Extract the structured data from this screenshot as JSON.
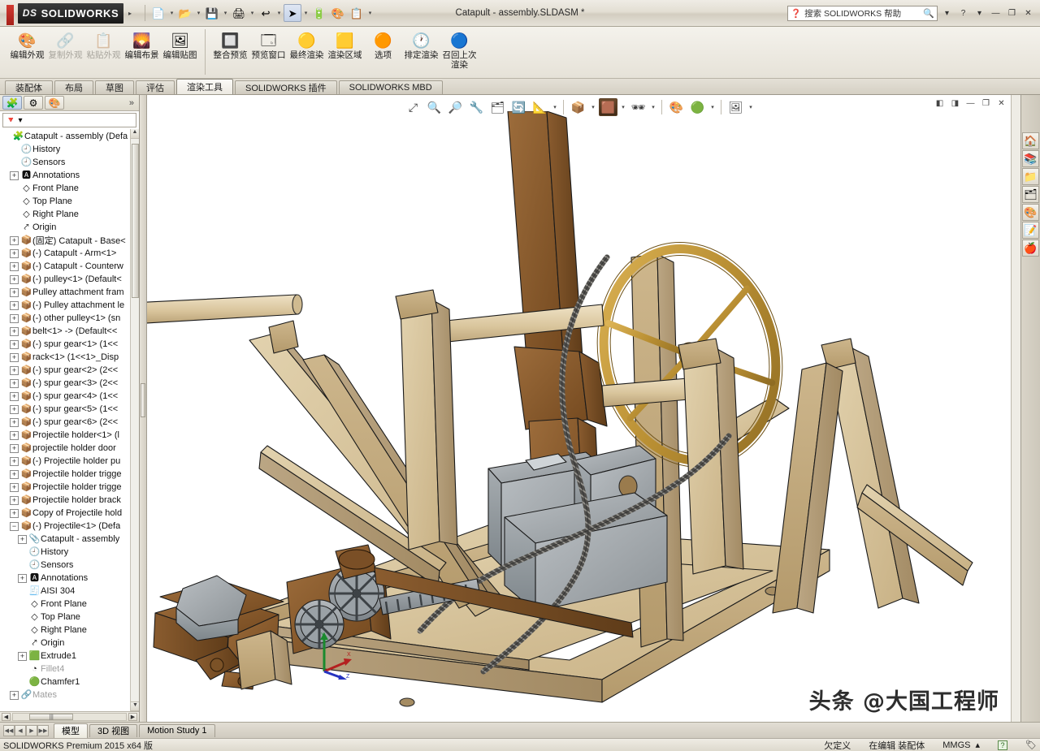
{
  "window": {
    "title": "Catapult - assembly.SLDASM *",
    "brand": "SOLIDWORKS",
    "brand_prefix": "DS",
    "search_placeholder": "搜索 SOLIDWORKS 帮助",
    "help_label": "?",
    "minimize_label": "—",
    "maximize_label": "❐",
    "close_label": "✕"
  },
  "quick_access": [
    {
      "name": "new-document",
      "icon": "📄"
    },
    {
      "name": "open-document",
      "icon": "📂"
    },
    {
      "name": "save-document",
      "icon": "💾"
    },
    {
      "name": "print",
      "icon": "🖨"
    },
    {
      "name": "undo",
      "icon": "↩"
    },
    {
      "name": "select",
      "icon": "➤"
    },
    {
      "name": "measure",
      "icon": "🔋"
    },
    {
      "name": "appearance",
      "icon": "🎨"
    },
    {
      "name": "options",
      "icon": "📋"
    }
  ],
  "ribbon": {
    "groups": [
      {
        "buttons": [
          {
            "label": "编辑外观",
            "icon": "🎨",
            "enabled": true
          },
          {
            "label": "复制外观",
            "icon": "🔗",
            "enabled": false
          },
          {
            "label": "粘贴外观",
            "icon": "📋",
            "enabled": false
          },
          {
            "label": "编辑布景",
            "icon": "🌄",
            "enabled": true
          },
          {
            "label": "编辑贴图",
            "icon": "🖼",
            "enabled": true
          }
        ]
      },
      {
        "buttons": [
          {
            "label": "整合预览",
            "icon": "🔲",
            "enabled": true
          },
          {
            "label": "预览窗口",
            "icon": "🗔",
            "enabled": true
          },
          {
            "label": "最终渲染",
            "icon": "🟡",
            "enabled": true
          },
          {
            "label": "渲染区域",
            "icon": "🟨",
            "enabled": true
          },
          {
            "label": "选项",
            "icon": "🟠",
            "enabled": true
          },
          {
            "label": "排定渲染",
            "icon": "🕐",
            "enabled": true
          },
          {
            "label": "召回上次渲染",
            "icon": "🔵",
            "enabled": true
          }
        ]
      }
    ]
  },
  "tabs": [
    {
      "label": "装配体",
      "active": false
    },
    {
      "label": "布局",
      "active": false
    },
    {
      "label": "草图",
      "active": false
    },
    {
      "label": "评估",
      "active": false
    },
    {
      "label": "渲染工具",
      "active": true
    },
    {
      "label": "SOLIDWORKS 插件",
      "active": false
    },
    {
      "label": "SOLIDWORKS MBD",
      "active": false
    }
  ],
  "tree_panel": {
    "header_icons": [
      {
        "name": "feature-manager-tab",
        "icon": "🧩",
        "active": true
      },
      {
        "name": "property-manager-tab",
        "icon": "⚙",
        "active": false
      },
      {
        "name": "display-manager-tab",
        "icon": "🎨",
        "active": false
      }
    ],
    "expand_label": "»",
    "filter_icon": "🔻",
    "filter_caret": "▾",
    "items": [
      {
        "label": "Catapult - assembly  (Defa",
        "icon": "🧩",
        "indent": 0,
        "expander": "",
        "depth": 0
      },
      {
        "label": "History",
        "icon": "🕘",
        "indent": 1,
        "expander": ""
      },
      {
        "label": "Sensors",
        "icon": "🕘",
        "indent": 1,
        "expander": ""
      },
      {
        "label": "Annotations",
        "icon": "🅰",
        "indent": 1,
        "expander": "+"
      },
      {
        "label": "Front Plane",
        "icon": "◇",
        "indent": 1,
        "expander": ""
      },
      {
        "label": "Top Plane",
        "icon": "◇",
        "indent": 1,
        "expander": ""
      },
      {
        "label": "Right Plane",
        "icon": "◇",
        "indent": 1,
        "expander": ""
      },
      {
        "label": "Origin",
        "icon": "⤤",
        "indent": 1,
        "expander": ""
      },
      {
        "label": "(固定) Catapult - Base<",
        "icon": "📦",
        "indent": 1,
        "expander": "+"
      },
      {
        "label": "(-) Catapult - Arm<1>",
        "icon": "📦",
        "indent": 1,
        "expander": "+"
      },
      {
        "label": "(-) Catapult - Counterw",
        "icon": "📦",
        "indent": 1,
        "expander": "+"
      },
      {
        "label": "(-) pulley<1> (Default<",
        "icon": "📦",
        "indent": 1,
        "expander": "+"
      },
      {
        "label": "Pulley attachment fram",
        "icon": "📦",
        "indent": 1,
        "expander": "+"
      },
      {
        "label": "(-) Pulley attachment le",
        "icon": "📦",
        "indent": 1,
        "expander": "+"
      },
      {
        "label": "(-) other pulley<1>  (sn",
        "icon": "📦",
        "indent": 1,
        "expander": "+"
      },
      {
        "label": "belt<1> -> (Default<<",
        "icon": "📦",
        "indent": 1,
        "expander": "+"
      },
      {
        "label": "(-) spur gear<1> (1<<",
        "icon": "📦",
        "indent": 1,
        "expander": "+"
      },
      {
        "label": "rack<1> (1<<1>_Disp",
        "icon": "📦",
        "indent": 1,
        "expander": "+"
      },
      {
        "label": "(-) spur gear<2> (2<<",
        "icon": "📦",
        "indent": 1,
        "expander": "+"
      },
      {
        "label": "(-) spur gear<3> (2<<",
        "icon": "📦",
        "indent": 1,
        "expander": "+"
      },
      {
        "label": "(-) spur gear<4> (1<<",
        "icon": "📦",
        "indent": 1,
        "expander": "+"
      },
      {
        "label": "(-) spur gear<5> (1<<",
        "icon": "📦",
        "indent": 1,
        "expander": "+"
      },
      {
        "label": "(-) spur gear<6> (2<<",
        "icon": "📦",
        "indent": 1,
        "expander": "+"
      },
      {
        "label": "Projectile holder<1> (l",
        "icon": "📦",
        "indent": 1,
        "expander": "+"
      },
      {
        "label": "projectile holder door",
        "icon": "📦",
        "indent": 1,
        "expander": "+"
      },
      {
        "label": "(-) Projectile holder pu",
        "icon": "📦",
        "indent": 1,
        "expander": "+"
      },
      {
        "label": "Projectile holder trigge",
        "icon": "📦",
        "indent": 1,
        "expander": "+"
      },
      {
        "label": "Projectile holder trigge",
        "icon": "📦",
        "indent": 1,
        "expander": "+"
      },
      {
        "label": "Projectile holder brack",
        "icon": "📦",
        "indent": 1,
        "expander": "+"
      },
      {
        "label": "Copy of Projectile hold",
        "icon": "📦",
        "indent": 1,
        "expander": "+"
      },
      {
        "label": "(-) Projectile<1> (Defa",
        "icon": "📦",
        "indent": 1,
        "expander": "−"
      },
      {
        "label": "Catapult - assembly",
        "icon": "📎",
        "indent": 2,
        "expander": "+"
      },
      {
        "label": "History",
        "icon": "🕘",
        "indent": 2,
        "expander": ""
      },
      {
        "label": "Sensors",
        "icon": "🕘",
        "indent": 2,
        "expander": ""
      },
      {
        "label": "Annotations",
        "icon": "🅰",
        "indent": 2,
        "expander": "+"
      },
      {
        "label": "AISI 304",
        "icon": "🧾",
        "indent": 2,
        "expander": ""
      },
      {
        "label": "Front Plane",
        "icon": "◇",
        "indent": 2,
        "expander": ""
      },
      {
        "label": "Top Plane",
        "icon": "◇",
        "indent": 2,
        "expander": ""
      },
      {
        "label": "Right Plane",
        "icon": "◇",
        "indent": 2,
        "expander": ""
      },
      {
        "label": "Origin",
        "icon": "⤤",
        "indent": 2,
        "expander": ""
      },
      {
        "label": "Extrude1",
        "icon": "🟩",
        "indent": 2,
        "expander": "+"
      },
      {
        "label": "Fillet4",
        "icon": "◔",
        "indent": 2,
        "expander": "",
        "greyed": true
      },
      {
        "label": "Chamfer1",
        "icon": "🟢",
        "indent": 2,
        "expander": ""
      },
      {
        "label": "Mates",
        "icon": "🔗",
        "indent": 1,
        "expander": "+",
        "greyed": true
      }
    ]
  },
  "viewport": {
    "toolbar": [
      {
        "name": "zoom-to-fit-icon",
        "icon": "⤢"
      },
      {
        "name": "zoom-to-area-icon",
        "icon": "🔍"
      },
      {
        "name": "zoom-in-out-icon",
        "icon": "🔎"
      },
      {
        "name": "section-view-icon",
        "icon": "🔧"
      },
      {
        "name": "view-orientation-icon",
        "icon": "🗂"
      },
      {
        "name": "rotate-view-icon",
        "icon": "🔄"
      },
      {
        "name": "display-style-icon",
        "icon": "📐",
        "caret": true
      },
      {
        "name": "hide-show-items-icon",
        "icon": "📦"
      },
      {
        "name": "edit-appearance-icon",
        "icon": "🟫",
        "selected": true,
        "caret": true
      },
      {
        "name": "apply-scene-icon",
        "icon": "🕶",
        "caret": true
      },
      {
        "name": "view-settings-icon",
        "icon": "🎨"
      },
      {
        "name": "appearance-callout-icon",
        "icon": "🟢",
        "caret": true
      },
      {
        "name": "display-pane-icon",
        "icon": "🖼",
        "caret": true
      }
    ],
    "window_buttons": [
      {
        "name": "restore-left-icon",
        "icon": "◧"
      },
      {
        "name": "restore-right-icon",
        "icon": "◨"
      },
      {
        "name": "minimize-doc-icon",
        "icon": "—"
      },
      {
        "name": "maximize-doc-icon",
        "icon": "❐"
      },
      {
        "name": "close-doc-icon",
        "icon": "✕"
      }
    ],
    "triad": {
      "x": "X",
      "y": "Y",
      "z": "Z"
    },
    "watermark": "头条 @大国工程师"
  },
  "task_pane": [
    {
      "name": "sw-resources-icon",
      "icon": "🏠"
    },
    {
      "name": "design-library-icon",
      "icon": "📚"
    },
    {
      "name": "file-explorer-icon",
      "icon": "📁"
    },
    {
      "name": "view-palette-icon",
      "icon": "🗂"
    },
    {
      "name": "appearances-scenes-icon",
      "icon": "🎨"
    },
    {
      "name": "custom-properties-icon",
      "icon": "📝"
    },
    {
      "name": "sw-forum-icon",
      "icon": "🍎"
    }
  ],
  "bottom_tabs": {
    "nav": [
      "◀◀",
      "◀",
      "▶",
      "▶▶"
    ],
    "tabs": [
      {
        "label": "模型",
        "active": true
      },
      {
        "label": "3D 视图",
        "active": false
      },
      {
        "label": "Motion Study 1",
        "active": false
      }
    ]
  },
  "status_bar": {
    "version": "SOLIDWORKS Premium 2015 x64 版",
    "state": "欠定义",
    "edit_mode": "在编辑 装配体",
    "units": "MMGS",
    "units_caret": "▴",
    "help_icon": "?",
    "tag_icon": "🏷"
  },
  "colors": {
    "accent_red": "#c0392b",
    "wood_light": "#d6c39a",
    "wood_mid": "#c0a877",
    "wood_dark": "#8a5f33",
    "brass": "#c9a23e",
    "stone": "#9aa0a4",
    "rope": "#5b5a57"
  }
}
